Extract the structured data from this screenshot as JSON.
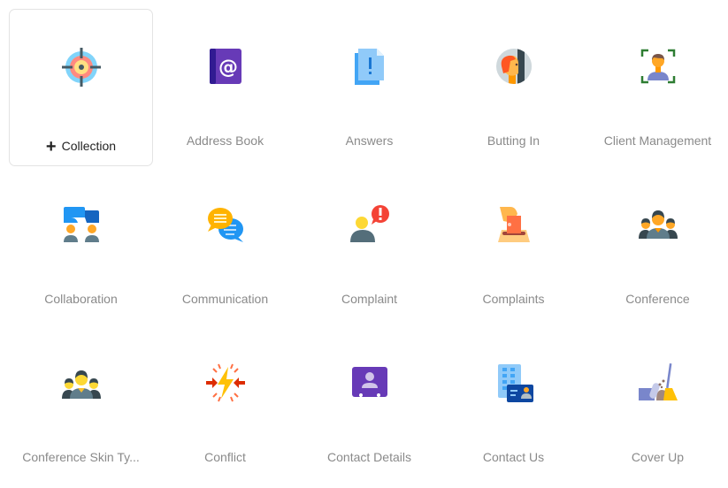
{
  "add_collection": {
    "label": "Collection",
    "plus_glyph": "+",
    "icon": "target-icon"
  },
  "icons": [
    {
      "label": "Address Book",
      "icon": "address-book-icon"
    },
    {
      "label": "Answers",
      "icon": "answers-icon"
    },
    {
      "label": "Butting In",
      "icon": "butting-in-icon"
    },
    {
      "label": "Client Management",
      "icon": "client-management-icon"
    },
    {
      "label": "Collaboration",
      "icon": "collaboration-icon"
    },
    {
      "label": "Communication",
      "icon": "communication-icon"
    },
    {
      "label": "Complaint",
      "icon": "complaint-icon"
    },
    {
      "label": "Complaints",
      "icon": "complaints-icon"
    },
    {
      "label": "Conference",
      "icon": "conference-icon"
    },
    {
      "label": "Conference Skin Ty...",
      "icon": "conference-skin-type-icon"
    },
    {
      "label": "Conflict",
      "icon": "conflict-icon"
    },
    {
      "label": "Contact Details",
      "icon": "contact-details-icon"
    },
    {
      "label": "Contact Us",
      "icon": "contact-us-icon"
    },
    {
      "label": "Cover Up",
      "icon": "cover-up-icon"
    }
  ],
  "colors": {
    "label_text": "#8a8a8a",
    "add_label_text": "#222222",
    "card_border": "#e3e3e3"
  }
}
